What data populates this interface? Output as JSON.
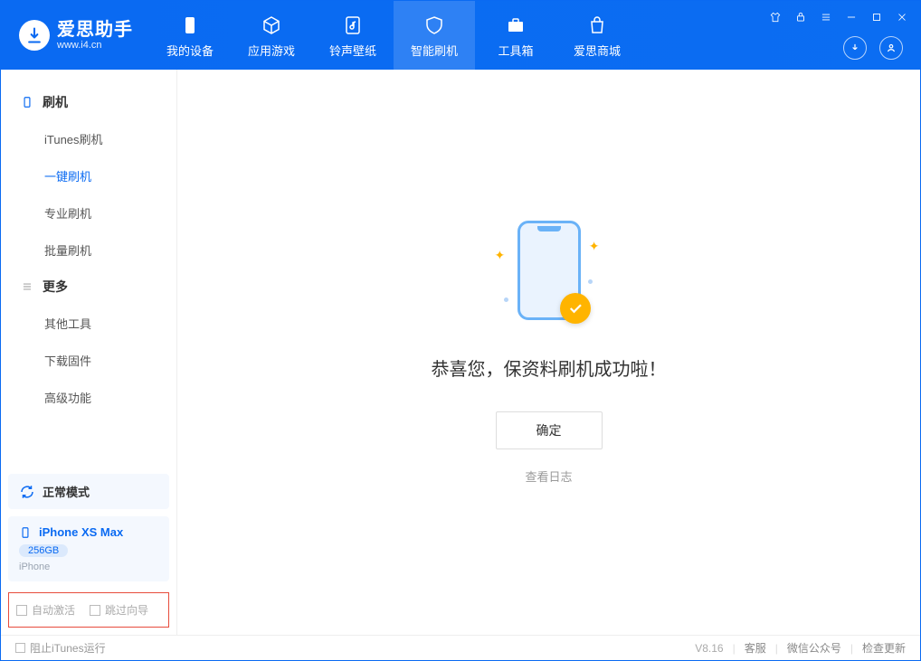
{
  "app": {
    "title": "爱思助手",
    "subtitle": "www.i4.cn"
  },
  "tabs": [
    {
      "label": "我的设备"
    },
    {
      "label": "应用游戏"
    },
    {
      "label": "铃声壁纸"
    },
    {
      "label": "智能刷机"
    },
    {
      "label": "工具箱"
    },
    {
      "label": "爱思商城"
    }
  ],
  "sidebar": {
    "group1_title": "刷机",
    "items1": [
      {
        "label": "iTunes刷机"
      },
      {
        "label": "一键刷机"
      },
      {
        "label": "专业刷机"
      },
      {
        "label": "批量刷机"
      }
    ],
    "group2_title": "更多",
    "items2": [
      {
        "label": "其他工具"
      },
      {
        "label": "下载固件"
      },
      {
        "label": "高级功能"
      }
    ],
    "mode": "正常模式",
    "device_name": "iPhone XS Max",
    "device_capacity": "256GB",
    "device_type": "iPhone",
    "check_auto_activate": "自动激活",
    "check_skip_guide": "跳过向导"
  },
  "content": {
    "success_text": "恭喜您，保资料刷机成功啦！",
    "ok_button": "确定",
    "view_log": "查看日志"
  },
  "statusbar": {
    "block_itunes": "阻止iTunes运行",
    "version": "V8.16",
    "link_support": "客服",
    "link_wechat": "微信公众号",
    "link_update": "检查更新"
  }
}
